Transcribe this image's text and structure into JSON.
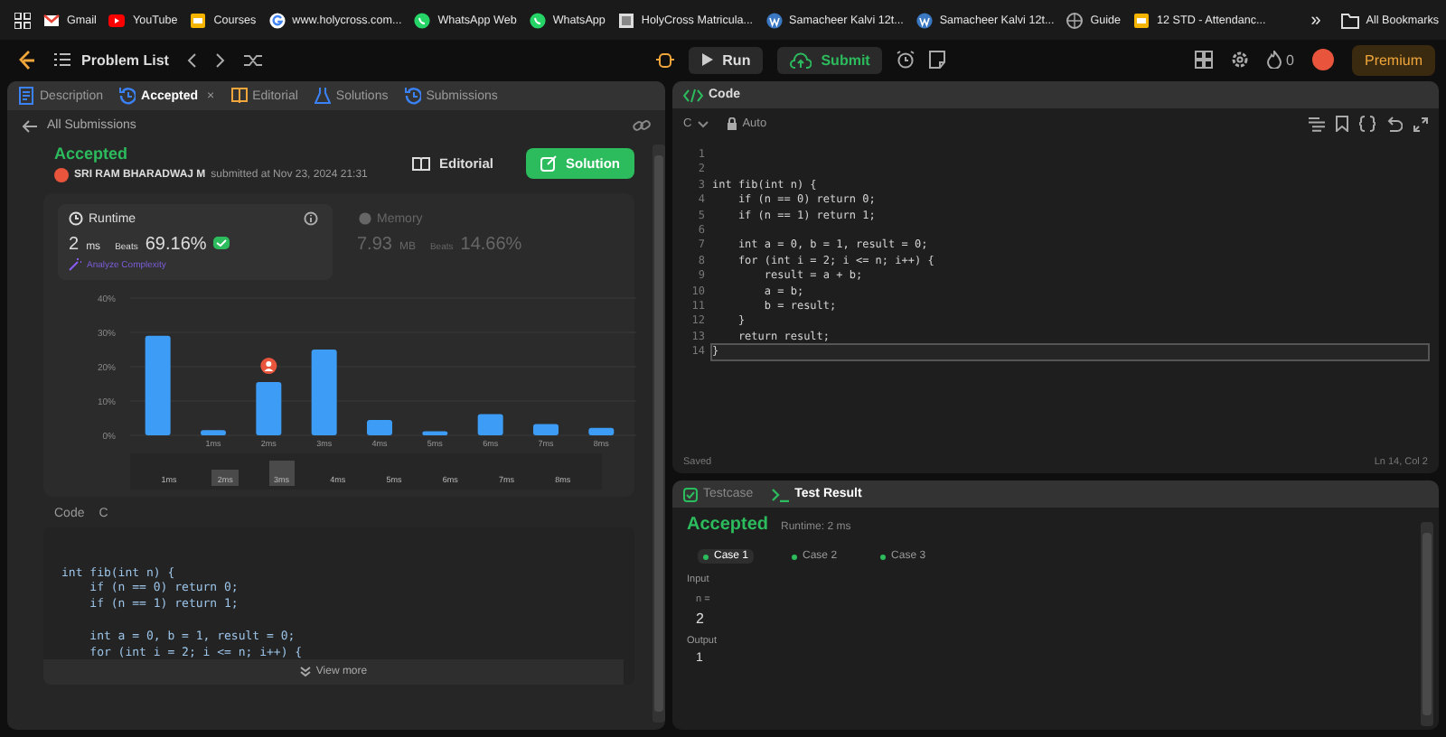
{
  "bookmarks": {
    "items": [
      {
        "label": "Gmail",
        "kind": "mail"
      },
      {
        "label": "YouTube",
        "kind": "video"
      },
      {
        "label": "Courses",
        "kind": "slides"
      },
      {
        "label": "www.holycross.com...",
        "kind": "search"
      },
      {
        "label": "WhatsApp Web",
        "kind": "chat"
      },
      {
        "label": "WhatsApp",
        "kind": "chat"
      },
      {
        "label": "HolyCross Matricula...",
        "kind": "page"
      },
      {
        "label": "Samacheer Kalvi 12t...",
        "kind": "wp"
      },
      {
        "label": "Samacheer Kalvi 12t...",
        "kind": "wp"
      },
      {
        "label": "Guide",
        "kind": "globe"
      },
      {
        "label": "12 STD - Attendanc...",
        "kind": "slides"
      }
    ],
    "more": "»",
    "all": "All Bookmarks"
  },
  "toolbar": {
    "problem_list": "Problem List",
    "run": "Run",
    "submit": "Submit",
    "streak": "0",
    "premium": "Premium"
  },
  "left_panel": {
    "tabs": [
      {
        "label": "Description",
        "selected": false,
        "kind": "doc"
      },
      {
        "label": "Accepted",
        "selected": true,
        "kind": "history",
        "close": "×"
      },
      {
        "label": "Editorial",
        "selected": false,
        "kind": "book"
      },
      {
        "label": "Solutions",
        "selected": false,
        "kind": "flask"
      },
      {
        "label": "Submissions",
        "selected": false,
        "kind": "history"
      }
    ],
    "back": "All Submissions",
    "status": "Accepted",
    "user": "SRI RAM BHARADWAJ M",
    "submitted": "submitted at Nov 23, 2024 21:31",
    "editorial_button": "Editorial",
    "solution_button": "Solution",
    "metrics": [
      {
        "title": "Runtime",
        "value": "2",
        "unit": "ms",
        "beats_label": "Beats",
        "beats": "69.16%",
        "selected": true,
        "link": "Analyze Complexity"
      },
      {
        "title": "Memory",
        "value": "7.93",
        "unit": "MB",
        "beats_label": "Beats",
        "beats": "14.66%",
        "selected": false
      }
    ],
    "chart_data": {
      "type": "bar",
      "grid": true,
      "categories": [
        null,
        "1ms",
        "2ms",
        "3ms",
        "4ms",
        "5ms",
        "6ms",
        "7ms",
        "8ms"
      ],
      "values": [
        29,
        1.5,
        15.5,
        25,
        4.5,
        1.2,
        6.2,
        3.3,
        2.2
      ],
      "ylim": [
        0,
        40
      ],
      "yticks": [
        {
          "value": 0,
          "label": "0%"
        },
        {
          "value": 10,
          "label": "10%"
        },
        {
          "value": 20,
          "label": "20%"
        },
        {
          "value": 30,
          "label": "30%"
        },
        {
          "value": 40,
          "label": "40%"
        }
      ]
    },
    "range": [
      {
        "label": "1ms",
        "kind": "plain",
        "you": false
      },
      {
        "label": "2ms",
        "kind": "short",
        "you": true
      },
      {
        "label": "3ms",
        "kind": "tall",
        "you": false
      },
      {
        "label": "4ms",
        "kind": "plain",
        "you": false
      },
      {
        "label": "5ms",
        "kind": "plain",
        "you": false
      },
      {
        "label": "6ms",
        "kind": "plain",
        "you": false
      },
      {
        "label": "7ms",
        "kind": "plain",
        "you": false
      },
      {
        "label": "8ms",
        "kind": "plain",
        "you": false
      }
    ],
    "code_label": "Code",
    "code_lang": "C",
    "snippet": [
      {
        "kind": "blank"
      },
      {
        "kind": "blank"
      },
      {
        "kind": "code",
        "text": "int fib(int n) {"
      },
      {
        "kind": "code",
        "text": "    if (n == 0) return 0;"
      },
      {
        "kind": "code",
        "text": "    if (n == 1) return 1;"
      },
      {
        "kind": "blank"
      },
      {
        "kind": "code",
        "text": "    int a = 0, b = 1, result = 0;"
      },
      {
        "kind": "code",
        "text": "    for (int i = 2; i <= n; i++) {"
      }
    ],
    "view_more": "View more"
  },
  "code_panel": {
    "title": "Code",
    "language": "C",
    "mode": "Auto",
    "lines": [
      {
        "num": "1",
        "current": false
      },
      {
        "num": "2",
        "current": false
      },
      {
        "num": "3",
        "current": false,
        "text": "int fib(int n) {"
      },
      {
        "num": "4",
        "current": false,
        "text": "    if (n == 0) return 0;"
      },
      {
        "num": "5",
        "current": false,
        "text": "    if (n == 1) return 1;"
      },
      {
        "num": "6",
        "current": false
      },
      {
        "num": "7",
        "current": false,
        "text": "    int a = 0, b = 1, result = 0;"
      },
      {
        "num": "8",
        "current": false,
        "text": "    for (int i = 2; i <= n; i++) {"
      },
      {
        "num": "9",
        "current": false,
        "text": "        result = a + b;"
      },
      {
        "num": "10",
        "current": false,
        "text": "        a = b;"
      },
      {
        "num": "11",
        "current": false,
        "text": "        b = result;"
      },
      {
        "num": "12",
        "current": false,
        "text": "    }"
      },
      {
        "num": "13",
        "current": false,
        "text": "    return result;"
      },
      {
        "num": "14",
        "current": true,
        "text": "}"
      }
    ],
    "saved": "Saved",
    "position": "Ln 14, Col 2"
  },
  "result_panel": {
    "tabs": [
      {
        "label": "Testcase",
        "selected": false,
        "kind": "check"
      },
      {
        "label": "Test Result",
        "selected": true,
        "kind": "prompt"
      }
    ],
    "status": "Accepted",
    "runtime": "Runtime: 2 ms",
    "cases": [
      {
        "label": "Case 1",
        "selected": true
      },
      {
        "label": "Case 2",
        "selected": false
      },
      {
        "label": "Case 3",
        "selected": false
      }
    ],
    "input_label": "Input",
    "param": "n =",
    "input_value": "2",
    "output_label": "Output",
    "output_value": "1"
  }
}
